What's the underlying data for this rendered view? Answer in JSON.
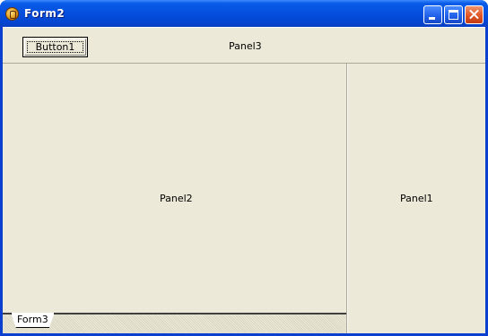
{
  "window": {
    "title": "Form2"
  },
  "panel3": {
    "caption": "Panel3",
    "button_label": "Button1"
  },
  "panel2": {
    "caption": "Panel2"
  },
  "panel1": {
    "caption": "Panel1"
  },
  "tabs": [
    {
      "label": "Form3"
    }
  ],
  "icons": {
    "app": "delphi-app-icon",
    "minimize": "minimize-icon",
    "maximize": "maximize-icon",
    "close": "close-icon"
  }
}
